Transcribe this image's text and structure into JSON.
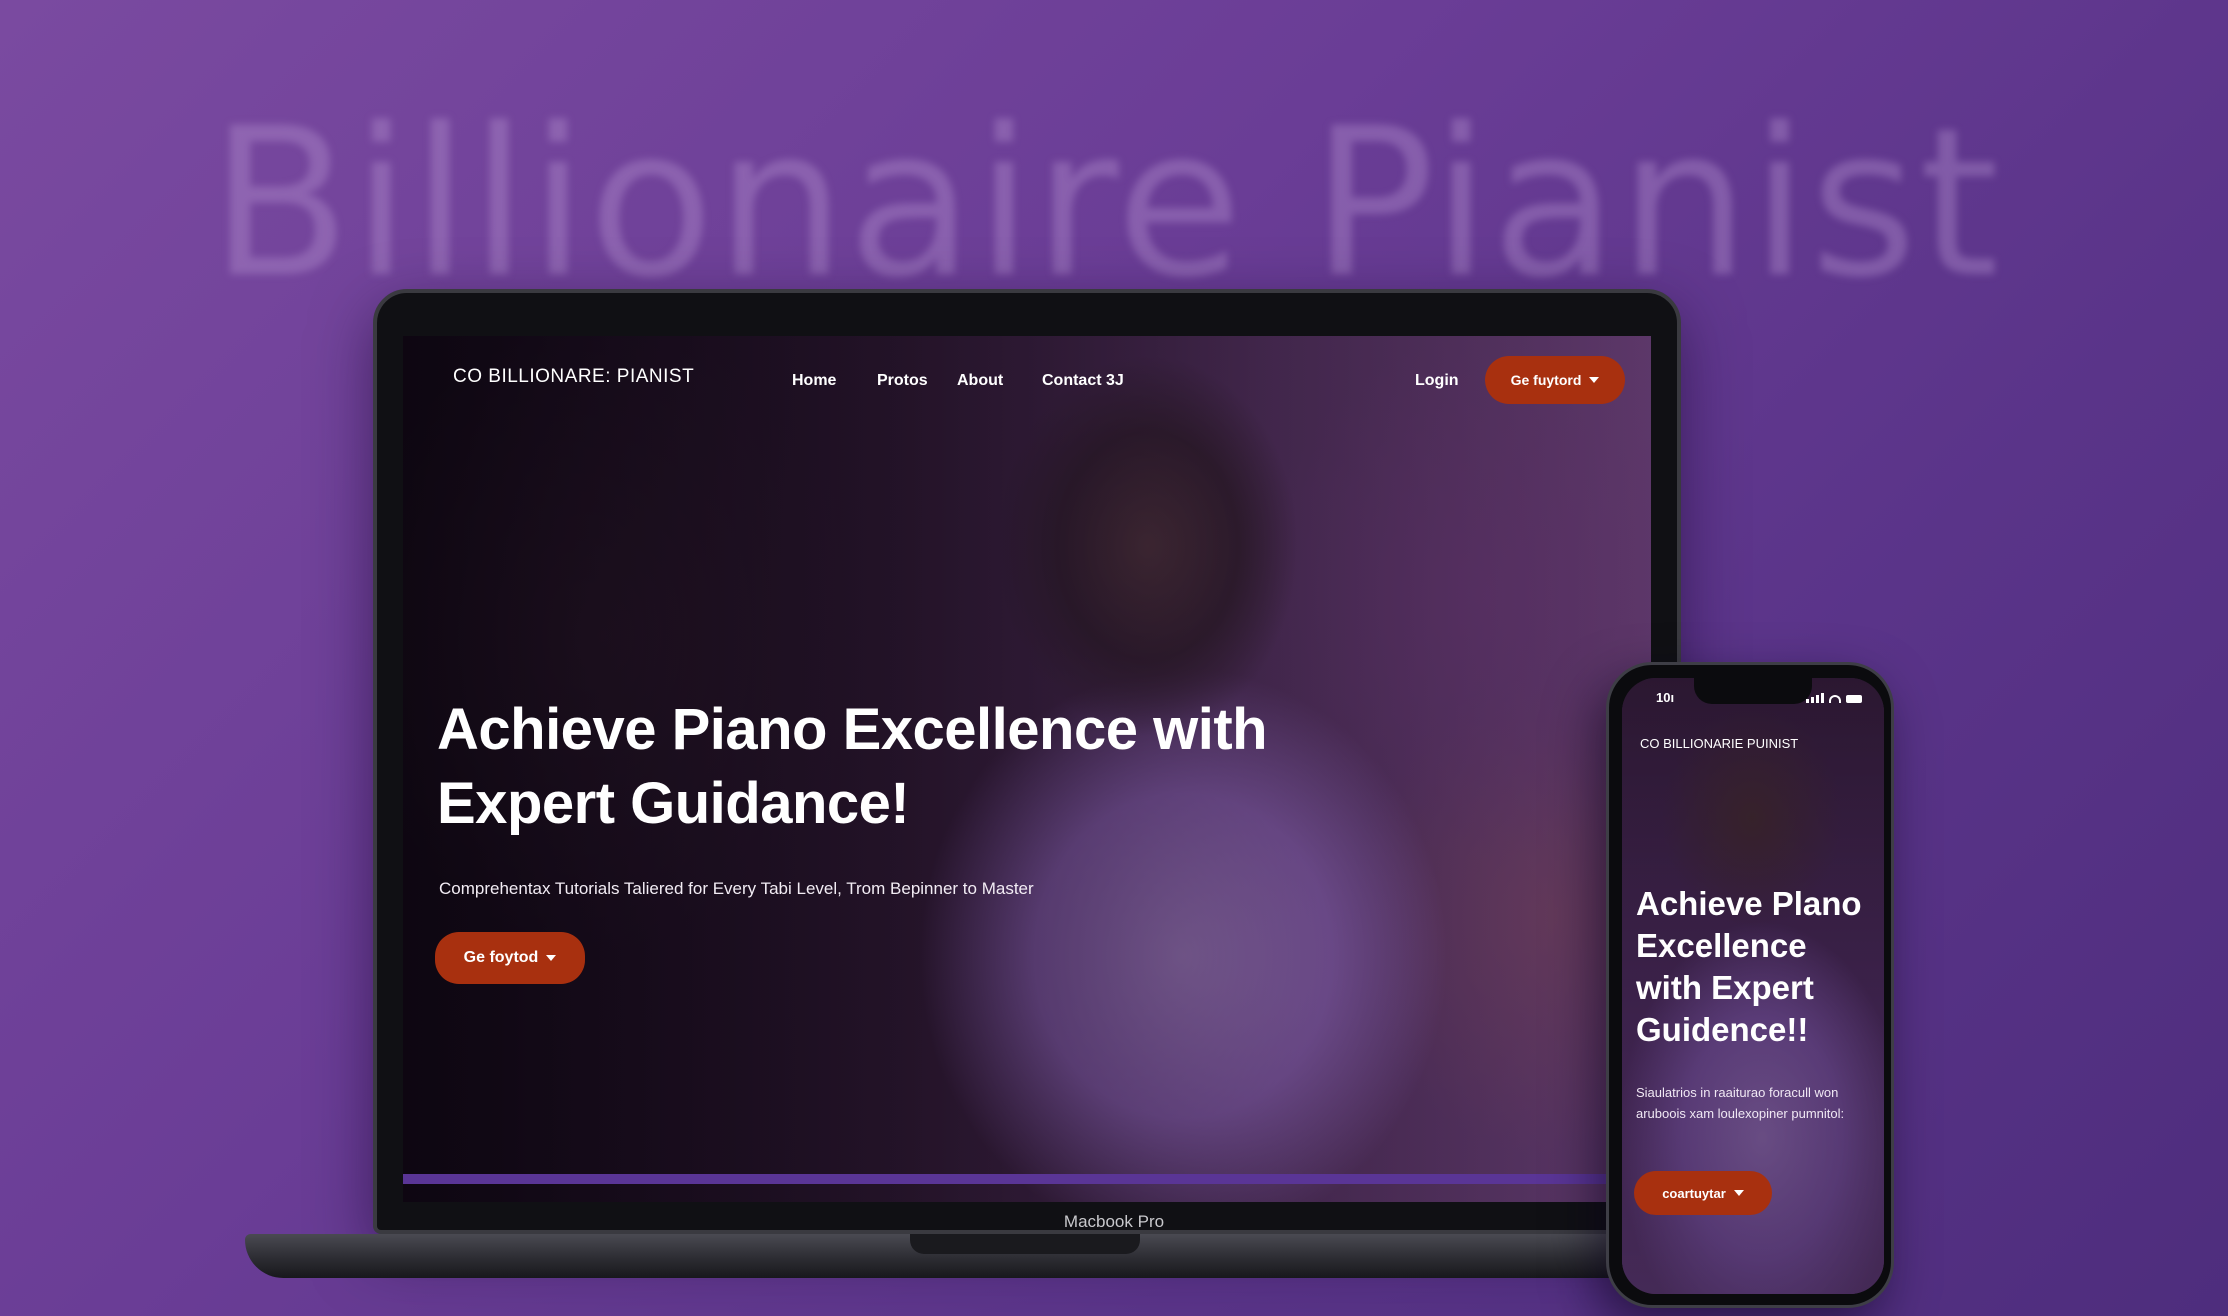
{
  "background_title": "Billionaire Pianist",
  "colors": {
    "background": "#6a3d96",
    "accent": "#a8300f",
    "screen_bar": "#5a3596"
  },
  "laptop": {
    "label": "Macbook Pro",
    "nav": {
      "logo": "CO BILLIONARE: PIANIST",
      "links": [
        "Home",
        "Protos",
        "About",
        "Contact 3J"
      ],
      "login": "Login",
      "cta": "Ge fuytord"
    },
    "hero": {
      "title": "Achieve Piano Excellence with Expert Guidance!",
      "subtitle": "Comprehentax Tutorials Taliered for Every Tabi Level, Trom Bepinner to Master",
      "cta": "Ge foytod"
    }
  },
  "phone": {
    "time": "10ı",
    "logo": "CO BILLIONARIE PUINIST",
    "title": "Achieve Plano Excellence with Expert Guidence!!",
    "subtitle": "Siaulatrios in raaiturao foracull won aruboois xam loulexopiner pumnitol:",
    "cta": "coartuytar"
  }
}
